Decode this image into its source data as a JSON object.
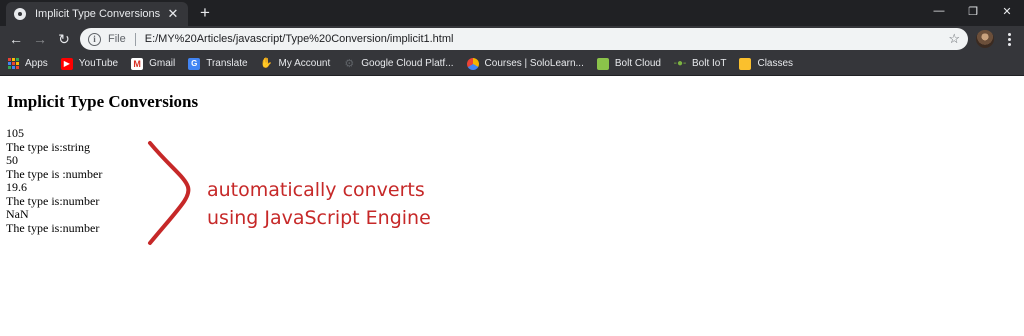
{
  "window": {
    "tab_title": "Implicit Type Conversions",
    "new_tab_symbol": "+",
    "controls": {
      "minimize": "—",
      "restore": "❐",
      "close": "✕"
    }
  },
  "toolbar": {
    "back": "←",
    "forward": "→",
    "reload": "↻",
    "scheme": "File",
    "url": "E:/MY%20Articles/javascript/Type%20Conversion/implicit1.html",
    "star": "☆"
  },
  "bookmarks": [
    {
      "label": "Apps",
      "icon": "apps-grid-icon"
    },
    {
      "label": "YouTube",
      "icon": "youtube-icon",
      "color": "#ff0000"
    },
    {
      "label": "Gmail",
      "icon": "gmail-icon",
      "color": "#d93025"
    },
    {
      "label": "Translate",
      "icon": "translate-icon",
      "color": "#4285f4"
    },
    {
      "label": "My Account",
      "icon": "account-icon",
      "color": "#9aa0a6"
    },
    {
      "label": "Google Cloud Platf...",
      "icon": "cloud-icon",
      "color": "#5f6368"
    },
    {
      "label": "Courses | SoloLearn...",
      "icon": "sololearn-icon",
      "color": "#f4b400"
    },
    {
      "label": "Bolt Cloud",
      "icon": "bolt-cloud-icon",
      "color": "#8bc34a"
    },
    {
      "label": "Bolt IoT",
      "icon": "bolt-iot-icon",
      "color": "#7cb342"
    },
    {
      "label": "Classes",
      "icon": "classes-icon",
      "color": "#fbc02d"
    }
  ],
  "page": {
    "heading": "Implicit Type Conversions",
    "output_lines": [
      "105",
      "The type is:string",
      "50",
      "The type is :number",
      "19.6",
      "The type is:number",
      "NaN",
      "The type is:number"
    ],
    "annotation": {
      "line1": "automatically converts",
      "line2": "using JavaScript Engine",
      "color": "#c62828"
    }
  },
  "colors": {
    "tabstrip": "#202124",
    "toolbar": "#35363a",
    "omnibox": "#f1f3f4"
  }
}
